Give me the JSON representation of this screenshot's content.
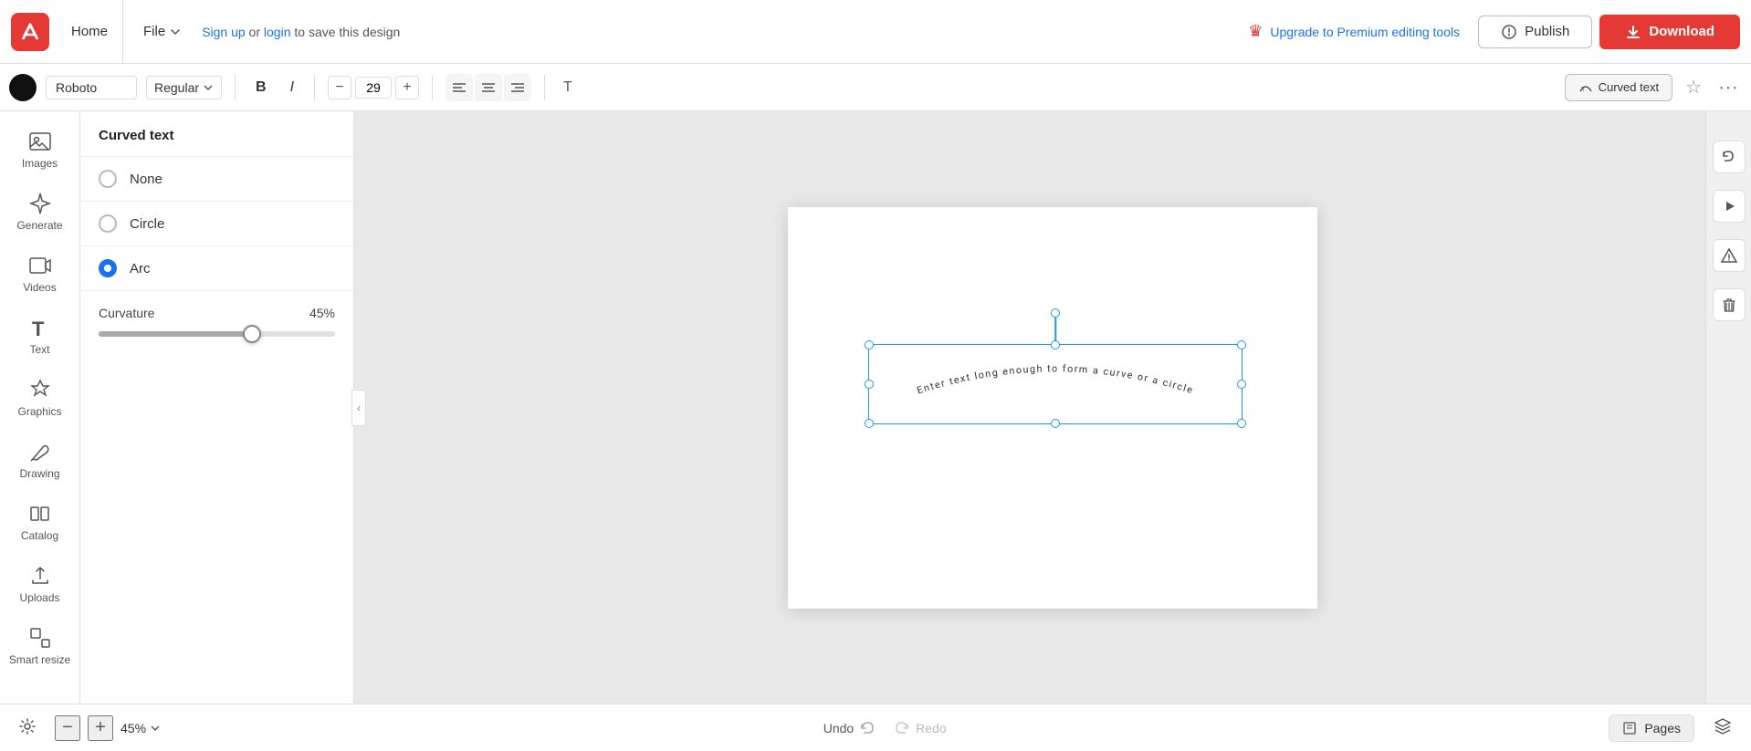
{
  "topbar": {
    "home_label": "Home",
    "file_label": "File",
    "save_text": " or ",
    "signup_label": "Sign up",
    "login_label": "login",
    "save_suffix": " to save this design",
    "upgrade_label": "Upgrade to Premium editing tools",
    "publish_label": "Publish",
    "download_label": "Download"
  },
  "toolbar2": {
    "font_name": "Roboto",
    "font_style": "Regular",
    "font_size": "29",
    "bold_label": "B",
    "italic_label": "I",
    "curved_text_label": "Curved text"
  },
  "panel": {
    "title": "Curved text",
    "options": [
      {
        "id": "none",
        "label": "None",
        "selected": false
      },
      {
        "id": "circle",
        "label": "Circle",
        "selected": false
      },
      {
        "id": "arc",
        "label": "Arc",
        "selected": true
      }
    ],
    "curvature_label": "Curvature",
    "curvature_value": "45%",
    "slider_pct": 65
  },
  "sidebar": {
    "items": [
      {
        "id": "images",
        "label": "Images"
      },
      {
        "id": "generate",
        "label": "Generate"
      },
      {
        "id": "videos",
        "label": "Videos"
      },
      {
        "id": "text",
        "label": "Text"
      },
      {
        "id": "graphics",
        "label": "Graphics"
      },
      {
        "id": "drawing",
        "label": "Drawing"
      },
      {
        "id": "catalog",
        "label": "Catalog"
      },
      {
        "id": "uploads",
        "label": "Uploads"
      },
      {
        "id": "smart-resize",
        "label": "Smart resize"
      }
    ]
  },
  "canvas": {
    "curved_text": "Enter text long enough to form a curve or a circle"
  },
  "bottombar": {
    "zoom_value": "45%",
    "undo_label": "Undo",
    "redo_label": "Redo",
    "pages_label": "Pages",
    "layers_label": "Layers"
  }
}
